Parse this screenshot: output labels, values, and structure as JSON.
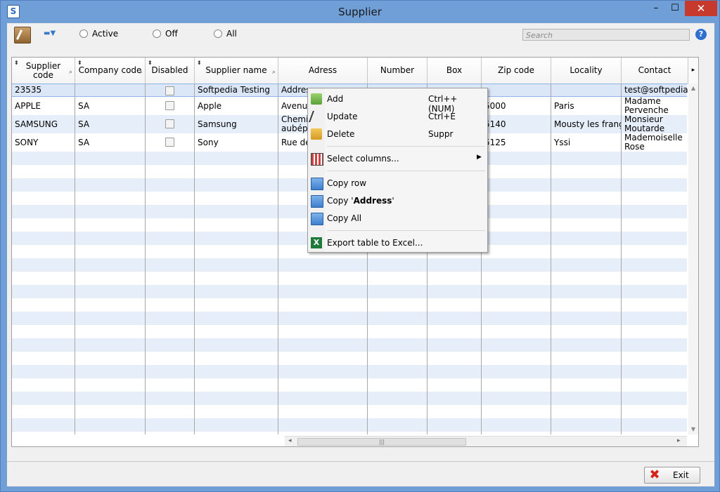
{
  "window": {
    "title": "Supplier",
    "app_icon": "S",
    "min_icon": "–",
    "max_icon": "☐",
    "close_icon": "✕"
  },
  "toolbar": {
    "radios": [
      {
        "label": "Active"
      },
      {
        "label": "Off"
      },
      {
        "label": "All"
      }
    ],
    "search_placeholder": "Search",
    "help_label": "?"
  },
  "columns": [
    {
      "label": "Supplier code"
    },
    {
      "label": "Company code"
    },
    {
      "label": "Disabled"
    },
    {
      "label": "Supplier name"
    },
    {
      "label": "Adress"
    },
    {
      "label": "Number"
    },
    {
      "label": "Box"
    },
    {
      "label": "Zip code"
    },
    {
      "label": "Locality"
    },
    {
      "label": "Contact"
    }
  ],
  "rows": [
    {
      "supplier_code": "23535",
      "company_code": "",
      "disabled": false,
      "supplier_name": "Softpedia Testing",
      "adress": "Addres",
      "number": "",
      "box": "",
      "zip": "",
      "locality": "",
      "contact": "test@softpedia.c"
    },
    {
      "supplier_code": "APPLE",
      "company_code": "SA",
      "disabled": false,
      "supplier_name": "Apple",
      "adress": "Avenue",
      "number": "",
      "box": "",
      "zip": "5000",
      "locality": "Paris",
      "contact": "Madame Pervenche"
    },
    {
      "supplier_code": "SAMSUNG",
      "company_code": "SA",
      "disabled": false,
      "supplier_name": "Samsung",
      "adress": "Chemin aubépi",
      "number": "",
      "box": "",
      "zip": "5140",
      "locality": "Mousty les frang",
      "contact": "Monsieur Moutarde"
    },
    {
      "supplier_code": "SONY",
      "company_code": "SA",
      "disabled": false,
      "supplier_name": "Sony",
      "adress": "Rue de",
      "number": "",
      "box": "",
      "zip": "5125",
      "locality": "Yssi",
      "contact": "Mademoiselle Rose"
    }
  ],
  "context_menu": {
    "add": {
      "label": "Add",
      "shortcut": "Ctrl++ (NUM)"
    },
    "update": {
      "label": "Update",
      "shortcut": "Ctrl+E"
    },
    "delete": {
      "label": "Delete",
      "shortcut": "Suppr"
    },
    "select_columns": {
      "label": "Select columns..."
    },
    "copy_row": {
      "label": "Copy row"
    },
    "copy_address_prefix": "Copy '",
    "copy_address_bold": "Address",
    "copy_address_suffix": "'",
    "copy_all": {
      "label": "Copy All"
    },
    "export": {
      "label": "Export table to Excel..."
    }
  },
  "footer": {
    "exit_label": "Exit"
  },
  "colors": {
    "title_bar": "#6f9fd6",
    "close_button": "#c7392c",
    "row_alt": "#e6eef9",
    "selected_row": "#dbe6f7"
  }
}
